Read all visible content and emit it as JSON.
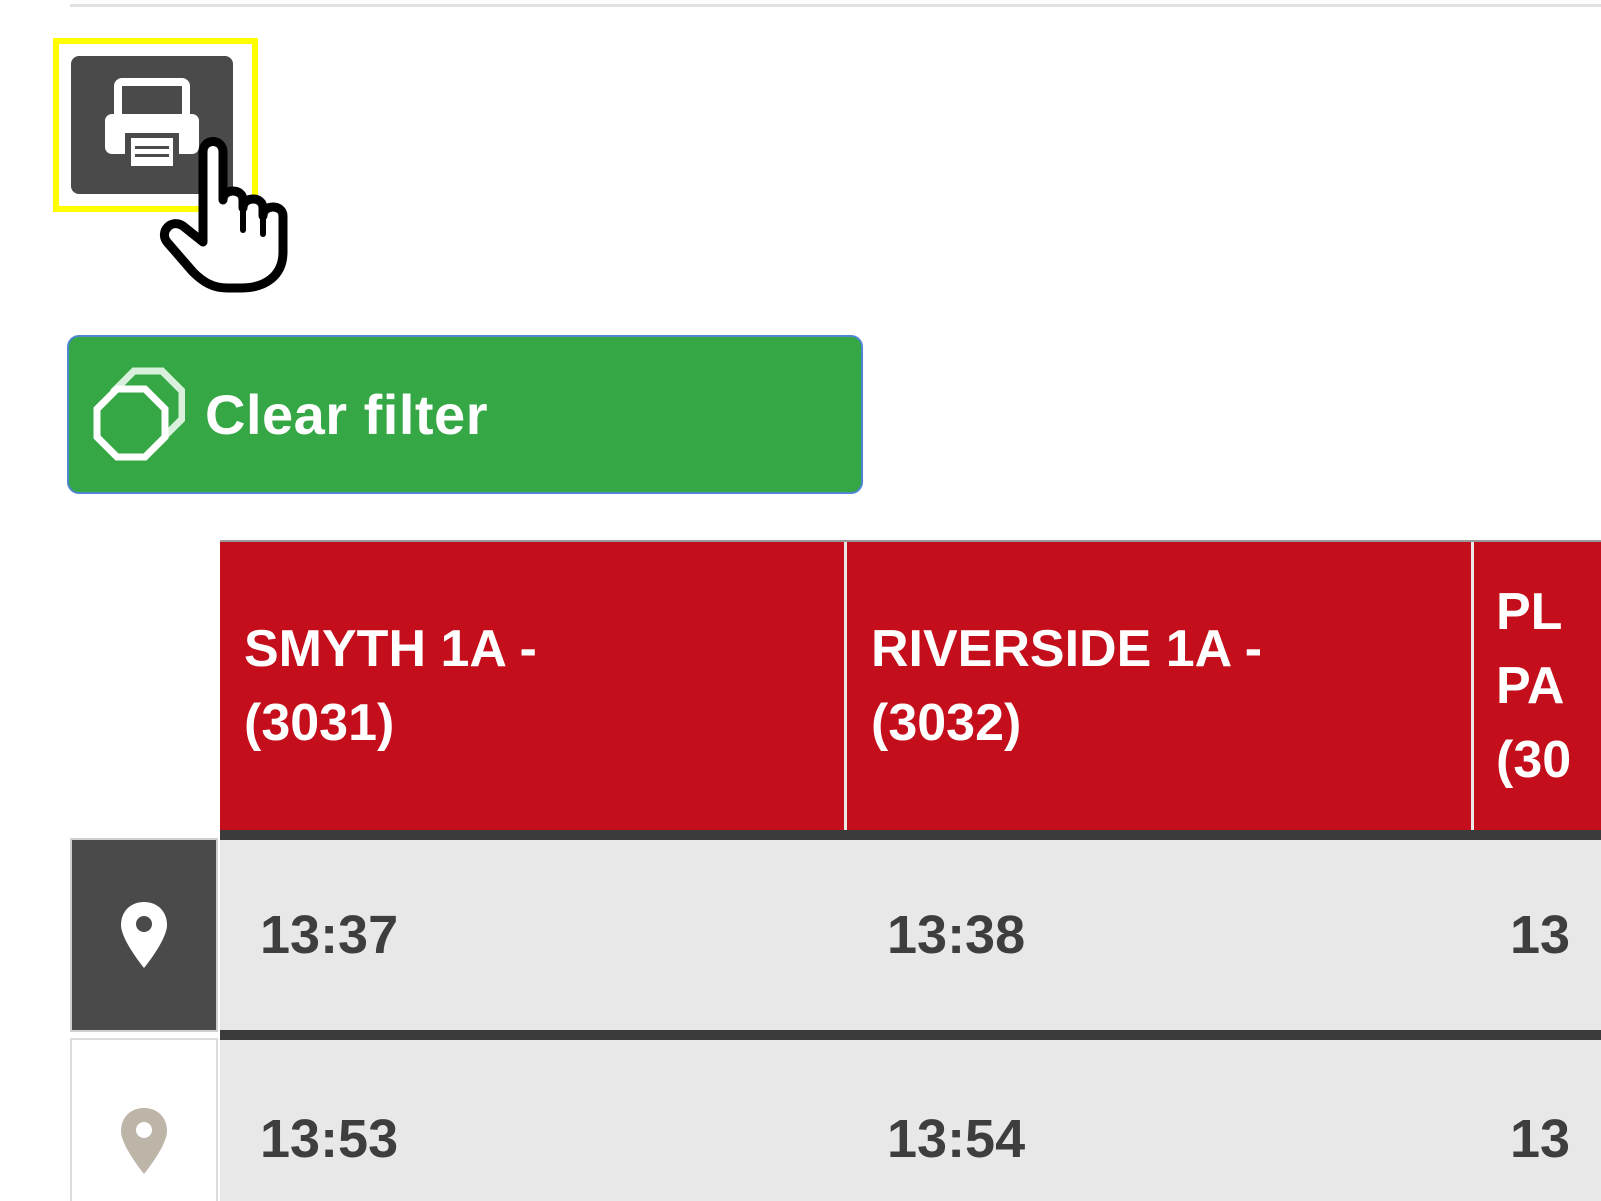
{
  "toolbar": {
    "print_icon": "printer-icon",
    "cursor_icon": "hand-pointer-icon"
  },
  "filter": {
    "clear_label": "Clear filter",
    "clear_icon": "octagon-stack-icon"
  },
  "colors": {
    "header_red": "#c50e1b",
    "button_green": "#35a745",
    "highlight_yellow": "#ffff00",
    "dark_gray": "#4a4a4a"
  },
  "timetable": {
    "stops": [
      {
        "label": "SMYTH 1A -\n(3031)"
      },
      {
        "label": "RIVERSIDE 1A -\n(3032)"
      },
      {
        "label": "PL\nPA\n(30"
      }
    ],
    "rows": [
      {
        "pin_icon": "map-pin-icon",
        "active": true,
        "times": [
          "13:37",
          "13:38",
          "13"
        ]
      },
      {
        "pin_icon": "map-pin-icon",
        "active": false,
        "times": [
          "13:53",
          "13:54",
          "13"
        ]
      }
    ]
  }
}
